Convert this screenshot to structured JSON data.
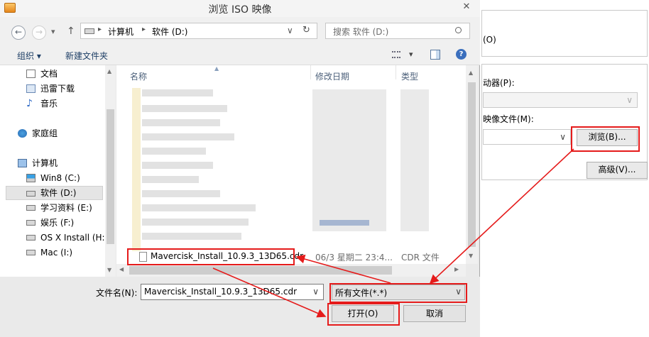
{
  "dialog": {
    "title": "浏览 ISO 映像",
    "close_glyph": "✕"
  },
  "nav": {
    "back_glyph": "←",
    "forward_glyph": "→",
    "recent_glyph": "▾",
    "up_glyph": "↑",
    "address_crumbs": [
      "计算机",
      "软件 (D:)"
    ],
    "crumb_sep": "▸",
    "address_dropdown_glyph": "∨",
    "refresh_glyph": "↻",
    "search_placeholder": "搜索 软件 (D:)"
  },
  "toolbar": {
    "organize_label": "组织 ▾",
    "new_folder_label": "新建文件夹",
    "view_dropdown_glyph": "▾",
    "help_glyph": "?"
  },
  "sidebar": {
    "items": [
      {
        "label": "文档",
        "icon": "document-icon"
      },
      {
        "label": "迅雷下载",
        "icon": "download-folder-icon"
      },
      {
        "label": "音乐",
        "icon": "music-icon"
      },
      {
        "label": "家庭组",
        "icon": "homegroup-icon"
      },
      {
        "label": "计算机",
        "icon": "computer-icon"
      },
      {
        "label": "Win8 (C:)",
        "icon": "windows-drive-icon"
      },
      {
        "label": "软件 (D:)",
        "icon": "drive-icon",
        "selected": true
      },
      {
        "label": "学习资料 (E:)",
        "icon": "drive-icon"
      },
      {
        "label": "娱乐 (F:)",
        "icon": "drive-icon"
      },
      {
        "label": "OS X Install (H:)",
        "icon": "drive-icon"
      },
      {
        "label": "Mac (I:)",
        "icon": "drive-icon"
      }
    ]
  },
  "file_list": {
    "columns": [
      "名称",
      "修改日期",
      "类型"
    ],
    "visible_file": {
      "name": "Mavercisk_Install_10.9.3_13D65.cdr",
      "modified": "06/3 星期二 23:4...",
      "type": "CDR 文件"
    }
  },
  "bottom": {
    "filename_label": "文件名(N):",
    "filename_value": "Mavercisk_Install_10.9.3_13D65.cdr",
    "filetype_value": "所有文件(*.*)",
    "open_label": "打开(O)",
    "cancel_label": "取消"
  },
  "background_dialog": {
    "option_o": "(O)",
    "drive_label": "动器(P):",
    "image_label": "映像文件(M):",
    "browse_label": "浏览(B)...",
    "advanced_label": "高级(V)..."
  },
  "colors": {
    "highlight_red": "#e51b1b",
    "selected_bg": "#e5e5e5",
    "header_text": "#4c607a"
  }
}
